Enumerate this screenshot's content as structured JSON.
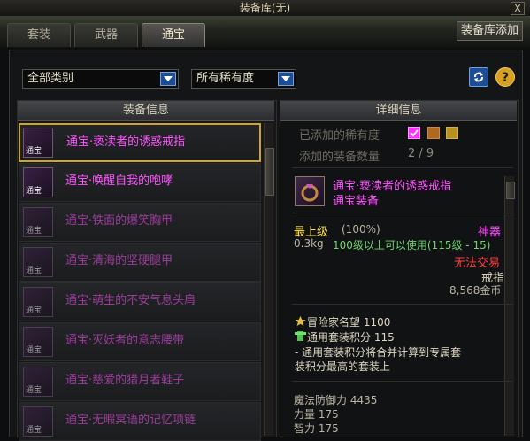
{
  "window": {
    "title": "装备库(无)",
    "close": "X"
  },
  "tabs": [
    "套装",
    "武器",
    "通宝"
  ],
  "add_button": "装备库添加",
  "filters": {
    "category": "全部类别",
    "rarity": "所有稀有度"
  },
  "left_header": "装备信息",
  "right_header": "详细信息",
  "items": [
    {
      "name": "通宝·亵渎者的诱惑戒指",
      "selected": true
    },
    {
      "name": "通宝·唤醒自我的咆哮"
    },
    {
      "name": "通宝·铁面的爆笑胸甲"
    },
    {
      "name": "通宝·清海的坚硬腿甲"
    },
    {
      "name": "通宝·萌生的不安气息头肩"
    },
    {
      "name": "通宝·灭妖者的意志腰带"
    },
    {
      "name": "通宝·慈爱的猎月者鞋子"
    },
    {
      "name": "通宝·无暇冥语的记忆项链"
    }
  ],
  "item_icon_tag": "通宝",
  "detail": {
    "rarity_added_label": "已添加的稀有度",
    "added_count_label": "添加的装备数量",
    "added_count": "2 / 9",
    "name": "通宝·亵渎者的诱惑戒指",
    "subtitle": "通宝装备",
    "level": "最上级",
    "level_pct": "(100%)",
    "grade": "神器",
    "weight": "0.3kg",
    "requirement": "100级以上可以使用(115级 - 15)",
    "trade": "无法交易",
    "type": "戒指",
    "price": "8,568金币",
    "fame": "冒险家名望 1100",
    "set_points": "通用套装积分 115",
    "set_note_1": "- 通用套装积分将合并计算到专属套",
    "set_note_2": "装积分最高的套装上",
    "stats": [
      "魔法防御力 4435",
      "力量 175",
      "智力 175"
    ]
  },
  "colors": {
    "bright_item": "#ff52ff",
    "dim_item": "#9b3d9c",
    "gold": "#cfa528",
    "epic": "#ff44ff"
  }
}
